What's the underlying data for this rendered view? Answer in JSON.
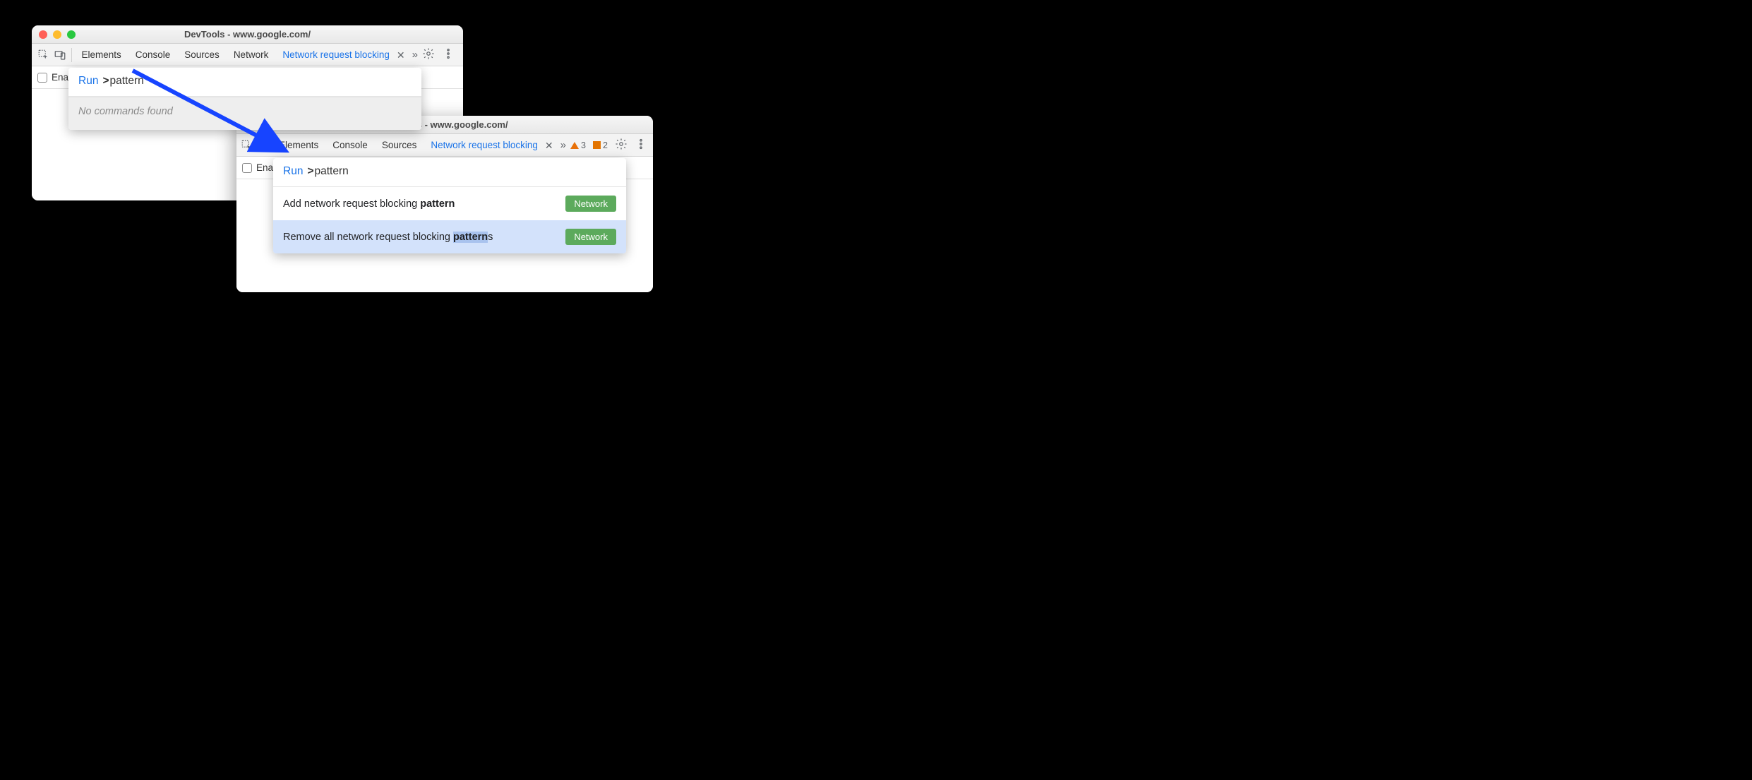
{
  "window1": {
    "title": "DevTools - www.google.com/",
    "tabs": {
      "elements": "Elements",
      "console": "Console",
      "sources": "Sources",
      "network": "Network",
      "blocking": "Network request blocking"
    },
    "enable_label": "Enab",
    "cmd_run": "Run",
    "cmd_prefix": ">",
    "cmd_query": "pattern",
    "cmd_empty": "No commands found"
  },
  "window2": {
    "title": "DevTools - www.google.com/",
    "tabs": {
      "elements": "Elements",
      "console": "Console",
      "sources": "Sources",
      "blocking": "Network request blocking"
    },
    "warnings_count": "3",
    "issues_count": "2",
    "enable_label": "Enab",
    "cmd_run": "Run",
    "cmd_prefix": ">",
    "cmd_query": "pattern",
    "items": [
      {
        "pre": "Add network request blocking ",
        "match": "pattern",
        "post": "",
        "badge": "Network"
      },
      {
        "pre": "Remove all network request blocking ",
        "match": "pattern",
        "post": "s",
        "badge": "Network"
      }
    ]
  }
}
